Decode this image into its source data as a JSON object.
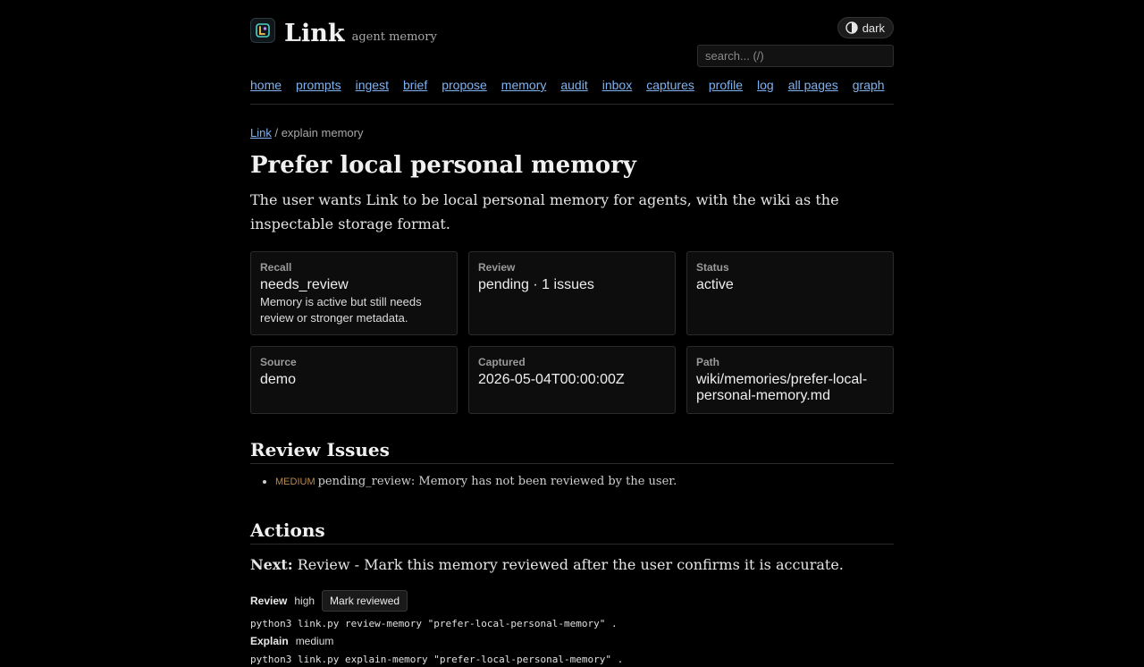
{
  "brand": {
    "name": "Link",
    "tagline": "agent memory"
  },
  "theme_toggle": {
    "label": "dark"
  },
  "search": {
    "placeholder": "search... (/)"
  },
  "nav": [
    "home",
    "prompts",
    "ingest",
    "brief",
    "propose",
    "memory",
    "audit",
    "inbox",
    "captures",
    "profile",
    "log",
    "all pages",
    "graph"
  ],
  "breadcrumb": {
    "root": "Link",
    "separator": " / ",
    "current": "explain memory"
  },
  "memory": {
    "title": "Prefer local personal memory",
    "summary": "The user wants Link to be local personal memory for agents, with the wiki as the inspectable storage format."
  },
  "cards": [
    {
      "label": "Recall",
      "value": "needs_review",
      "note": "Memory is active but still needs review or stronger metadata."
    },
    {
      "label": "Review",
      "value": "pending · 1 issues"
    },
    {
      "label": "Status",
      "value": "active"
    },
    {
      "label": "Source",
      "value": "demo"
    },
    {
      "label": "Captured",
      "value": "2026-05-04T00:00:00Z"
    },
    {
      "label": "Path",
      "value": "wiki/memories/prefer-local-personal-memory.md"
    }
  ],
  "review_issues": {
    "heading": "Review Issues",
    "items": [
      {
        "severity": "MEDIUM",
        "text": "pending_review: Memory has not been reviewed by the user."
      }
    ]
  },
  "actions": {
    "heading": "Actions",
    "next_label": "Next:",
    "next_text": "Review - Mark this memory reviewed after the user confirms it is accurate.",
    "items": [
      {
        "name": "Review",
        "priority": "high",
        "button": "Mark reviewed",
        "command": "python3 link.py review-memory \"prefer-local-personal-memory\" ."
      },
      {
        "name": "Explain",
        "priority": "medium",
        "command": "python3 link.py explain-memory \"prefer-local-personal-memory\" ."
      }
    ]
  },
  "colors": {
    "background": "#000000",
    "link": "#7fb2f0",
    "severity_medium": "#b88a4f"
  }
}
